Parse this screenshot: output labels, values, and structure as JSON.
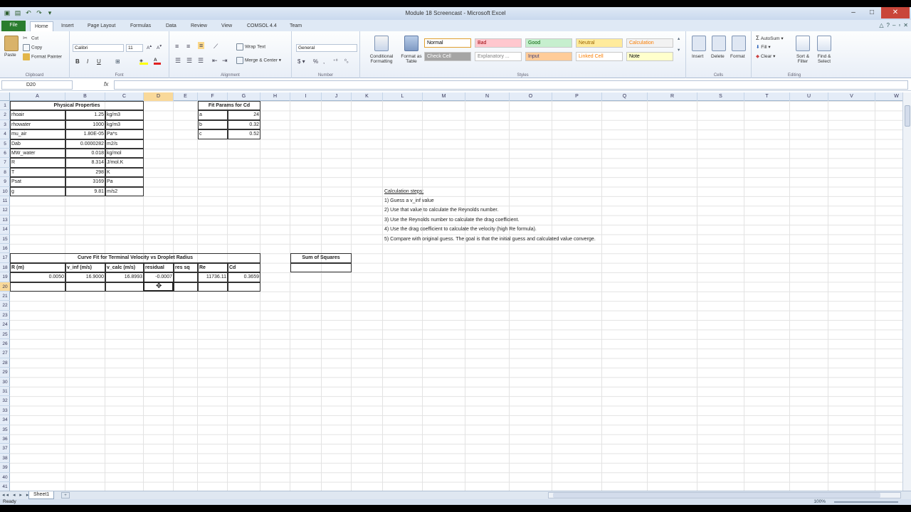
{
  "window": {
    "title": "Module 18 Screencast - Microsoft Excel"
  },
  "ribbon": {
    "tabs": [
      "File",
      "Home",
      "Insert",
      "Page Layout",
      "Formulas",
      "Data",
      "Review",
      "View",
      "COMSOL 4.4",
      "Team"
    ],
    "active_tab": "Home",
    "clipboard": {
      "paste": "Paste",
      "cut": "Cut",
      "copy": "Copy",
      "format_painter": "Format Painter",
      "label": "Clipboard"
    },
    "font": {
      "name": "Calibri",
      "size": "11",
      "label": "Font"
    },
    "alignment": {
      "wrap_text": "Wrap Text",
      "merge_center": "Merge & Center",
      "label": "Alignment"
    },
    "number": {
      "format": "General",
      "label": "Number"
    },
    "styles": {
      "conditional_formatting": "Conditional Formatting",
      "format_as_table": "Format as Table",
      "cells": [
        {
          "label": "Normal",
          "bg": "#ffffff",
          "fg": "#000000"
        },
        {
          "label": "Bad",
          "bg": "#ffc7ce",
          "fg": "#9c0006"
        },
        {
          "label": "Good",
          "bg": "#c6efce",
          "fg": "#006100"
        },
        {
          "label": "Neutral",
          "bg": "#ffeb9c",
          "fg": "#9c6500"
        },
        {
          "label": "Calculation",
          "bg": "#f2f2f2",
          "fg": "#fa7d00"
        },
        {
          "label": "Check Cell",
          "bg": "#a5a5a5",
          "fg": "#ffffff"
        },
        {
          "label": "Explanatory ...",
          "bg": "#ffffff",
          "fg": "#7f7f7f"
        },
        {
          "label": "Input",
          "bg": "#ffcc99",
          "fg": "#3f3f76"
        },
        {
          "label": "Linked Cell",
          "bg": "#ffffff",
          "fg": "#fa7d00"
        },
        {
          "label": "Note",
          "bg": "#ffffcc",
          "fg": "#000000"
        }
      ],
      "label": "Styles"
    },
    "cells_group": {
      "insert": "Insert",
      "delete": "Delete",
      "format": "Format",
      "label": "Cells"
    },
    "editing": {
      "autosum": "AutoSum",
      "fill": "Fill",
      "clear": "Clear",
      "sort_filter": "Sort & Filter",
      "find_select": "Find & Select",
      "label": "Editing"
    }
  },
  "formula_bar": {
    "name_box": "D20",
    "fx": "fx",
    "content": ""
  },
  "columns": [
    "A",
    "B",
    "C",
    "D",
    "E",
    "F",
    "G",
    "H",
    "I",
    "J",
    "K",
    "L",
    "M",
    "N",
    "O",
    "P",
    "Q",
    "R",
    "S",
    "T",
    "U",
    "V",
    "W"
  ],
  "selected_column": "D",
  "selected_row": "20",
  "sheet": {
    "physical_properties": {
      "header": "Physical Properties",
      "rows": [
        {
          "name": "rhoair",
          "value": "1.25",
          "unit": "kg/m3"
        },
        {
          "name": "rhowater",
          "value": "1000",
          "unit": "kg/m3"
        },
        {
          "name": "mu_air",
          "value": "1.80E-05",
          "unit": "Pa*s"
        },
        {
          "name": "Dab",
          "value": "0.0000282",
          "unit": "m2/s"
        },
        {
          "name": "MW_water",
          "value": "0.018",
          "unit": "kg/mol"
        },
        {
          "name": "R",
          "value": "8.314",
          "unit": "J/mol.K"
        },
        {
          "name": "T",
          "value": "298",
          "unit": "K"
        },
        {
          "name": "Psat",
          "value": "3169",
          "unit": "Pa"
        },
        {
          "name": "g",
          "value": "9.81",
          "unit": "m/s2"
        }
      ]
    },
    "fit_params": {
      "header": "Fit Params for Cd",
      "rows": [
        {
          "name": "a",
          "value": "24"
        },
        {
          "name": "b",
          "value": "0.32"
        },
        {
          "name": "c",
          "value": "0.52"
        }
      ]
    },
    "curve_fit": {
      "header": "Curve Fit for Terminal Velocity vs Droplet Radius",
      "columns": [
        "R (m)",
        "v_inf (m/s)",
        "v_calc (m/s)",
        "residual",
        "res sq",
        "Re",
        "Cd"
      ],
      "row": [
        "0.0050",
        "16.9000",
        "16.8993",
        "-0.0007",
        "",
        "11736.11",
        "0.3659"
      ]
    },
    "sum_of_squares": {
      "header": "Sum of Squares",
      "value": ""
    },
    "steps": {
      "title": "Calculation steps:",
      "items": [
        "1) Guess a v_inf value",
        "2) Use that value to calculate the Reynolds number.",
        "3) Use the Reynolds number to calculate the drag coefficient.",
        "4) Use the drag coefficient to calculate the velocity (high Re formula).",
        "5) Compare with original guess. The goal is that the initial guess and calculated value converge."
      ]
    }
  },
  "sheet_tabs": [
    "Sheet1"
  ],
  "status": {
    "text": "Ready",
    "zoom": "100%"
  }
}
